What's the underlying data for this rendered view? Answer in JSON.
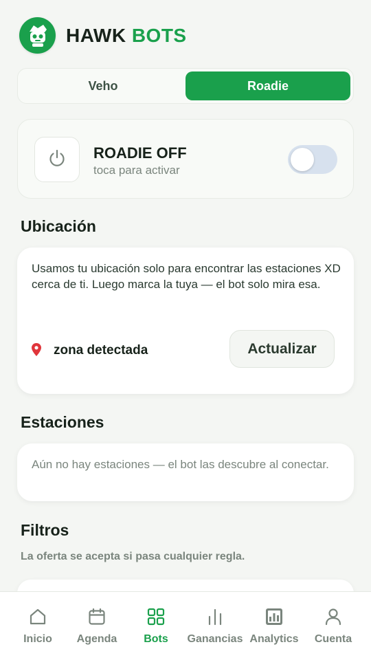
{
  "brand": {
    "part1": "HAWK",
    "part2": "BOTS"
  },
  "tabs": [
    {
      "label": "Veho",
      "active": false
    },
    {
      "label": "Roadie",
      "active": true
    }
  ],
  "power": {
    "title": "ROADIE OFF",
    "subtitle": "toca para activar",
    "toggle_on": false
  },
  "location": {
    "title": "Ubicación",
    "description": "Usamos tu ubicación solo para encontrar las estaciones XD cerca de ti. Luego marca la tuya — el bot solo mira esa.",
    "zone_label": "zona detectada",
    "update_button": "Actualizar"
  },
  "stations": {
    "title": "Estaciones",
    "empty_text": "Aún no hay estaciones — el bot las descubre al conectar."
  },
  "filters": {
    "title": "Filtros",
    "subtitle": "La oferta se acepta si pasa cualquier regla."
  },
  "nav": [
    {
      "label": "Inicio",
      "icon": "home-icon",
      "active": false
    },
    {
      "label": "Agenda",
      "icon": "calendar-icon",
      "active": false
    },
    {
      "label": "Bots",
      "icon": "grid-icon",
      "active": true
    },
    {
      "label": "Ganancias",
      "icon": "bars-icon",
      "active": false
    },
    {
      "label": "Analytics",
      "icon": "chart-icon",
      "active": false
    },
    {
      "label": "Cuenta",
      "icon": "user-icon",
      "active": false
    }
  ],
  "colors": {
    "accent": "#1aa04c",
    "text": "#17221a",
    "muted": "#7a857d",
    "background": "#f4f6f3"
  }
}
